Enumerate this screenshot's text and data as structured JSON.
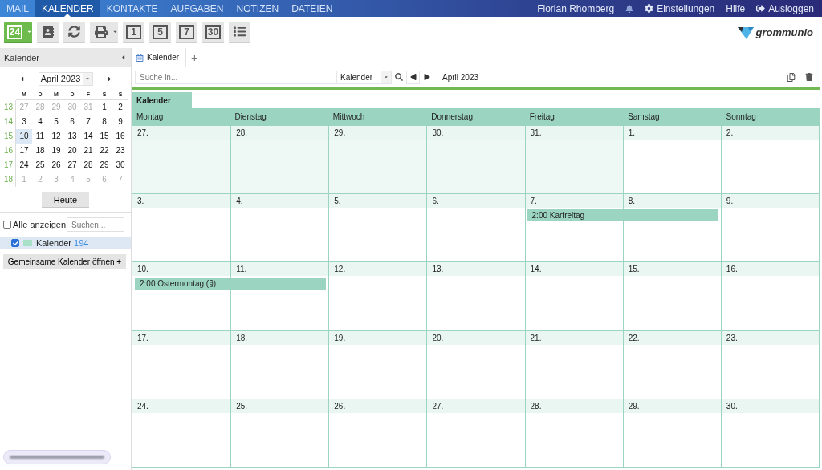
{
  "nav": {
    "tabs": [
      {
        "label": "MAIL",
        "selected": false
      },
      {
        "label": "KALENDER",
        "selected": true
      },
      {
        "label": "KONTAKTE",
        "selected": false
      },
      {
        "label": "AUFGABEN",
        "selected": false
      },
      {
        "label": "NOTIZEN",
        "selected": false
      },
      {
        "label": "DATEIEN",
        "selected": false
      }
    ],
    "user": "Florian Rhomberg",
    "settings": "Einstellungen",
    "help": "Hilfe",
    "logout": "Ausloggen"
  },
  "toolbar": {
    "buttons": [
      {
        "kind": "date",
        "label": "24",
        "dropdown": true,
        "highlighted": true
      },
      {
        "kind": "contacts",
        "dropdown": false,
        "highlighted": false
      },
      {
        "kind": "refresh",
        "dropdown": false,
        "highlighted": false
      },
      {
        "kind": "print",
        "dropdown": true,
        "highlighted": false
      },
      {
        "kind": "view",
        "label": "1",
        "dropdown": false,
        "highlighted": false
      },
      {
        "kind": "view",
        "label": "5",
        "dropdown": false,
        "highlighted": false
      },
      {
        "kind": "view",
        "label": "7",
        "dropdown": false,
        "highlighted": false
      },
      {
        "kind": "view",
        "label": "30",
        "dropdown": false,
        "highlighted": false
      },
      {
        "kind": "list",
        "dropdown": false,
        "highlighted": false
      }
    ],
    "logo": "grommunio"
  },
  "sidebar": {
    "title": "Kalender",
    "month": "April 2023",
    "weekdays": [
      "M",
      "D",
      "M",
      "D",
      "F",
      "S",
      "S"
    ],
    "weeks": [
      {
        "week": "13",
        "days": [
          {
            "label": "27",
            "outside": true,
            "selected": false
          },
          {
            "label": "28",
            "outside": true,
            "selected": false
          },
          {
            "label": "29",
            "outside": true,
            "selected": false
          },
          {
            "label": "30",
            "outside": true,
            "selected": false
          },
          {
            "label": "31",
            "outside": true,
            "selected": false
          },
          {
            "label": "1",
            "outside": false,
            "selected": false
          },
          {
            "label": "2",
            "outside": false,
            "selected": false
          }
        ]
      },
      {
        "week": "14",
        "days": [
          {
            "label": "3",
            "outside": false,
            "selected": false
          },
          {
            "label": "4",
            "outside": false,
            "selected": false
          },
          {
            "label": "5",
            "outside": false,
            "selected": false
          },
          {
            "label": "6",
            "outside": false,
            "selected": false
          },
          {
            "label": "7",
            "outside": false,
            "selected": false
          },
          {
            "label": "8",
            "outside": false,
            "selected": false
          },
          {
            "label": "9",
            "outside": false,
            "selected": false
          }
        ]
      },
      {
        "week": "15",
        "days": [
          {
            "label": "10",
            "outside": false,
            "selected": true
          },
          {
            "label": "11",
            "outside": false,
            "selected": false
          },
          {
            "label": "12",
            "outside": false,
            "selected": false
          },
          {
            "label": "13",
            "outside": false,
            "selected": false
          },
          {
            "label": "14",
            "outside": false,
            "selected": false
          },
          {
            "label": "15",
            "outside": false,
            "selected": false
          },
          {
            "label": "16",
            "outside": false,
            "selected": false
          }
        ]
      },
      {
        "week": "16",
        "days": [
          {
            "label": "17",
            "outside": false,
            "selected": false
          },
          {
            "label": "18",
            "outside": false,
            "selected": false
          },
          {
            "label": "19",
            "outside": false,
            "selected": false
          },
          {
            "label": "20",
            "outside": false,
            "selected": false
          },
          {
            "label": "21",
            "outside": false,
            "selected": false
          },
          {
            "label": "22",
            "outside": false,
            "selected": false
          },
          {
            "label": "23",
            "outside": false,
            "selected": false
          }
        ]
      },
      {
        "week": "17",
        "days": [
          {
            "label": "24",
            "outside": false,
            "selected": false
          },
          {
            "label": "25",
            "outside": false,
            "selected": false
          },
          {
            "label": "26",
            "outside": false,
            "selected": false
          },
          {
            "label": "27",
            "outside": false,
            "selected": false
          },
          {
            "label": "28",
            "outside": false,
            "selected": false
          },
          {
            "label": "29",
            "outside": false,
            "selected": false
          },
          {
            "label": "30",
            "outside": false,
            "selected": false
          }
        ]
      },
      {
        "week": "18",
        "days": [
          {
            "label": "1",
            "outside": true,
            "selected": false
          },
          {
            "label": "2",
            "outside": true,
            "selected": false
          },
          {
            "label": "3",
            "outside": true,
            "selected": false
          },
          {
            "label": "4",
            "outside": true,
            "selected": false
          },
          {
            "label": "5",
            "outside": true,
            "selected": false
          },
          {
            "label": "6",
            "outside": true,
            "selected": false
          },
          {
            "label": "7",
            "outside": true,
            "selected": false
          }
        ]
      }
    ],
    "today": "Heute",
    "show_all": {
      "label": "Alle anzeigen",
      "checked": false
    },
    "search": {
      "placeholder": "Suchen..."
    },
    "calendars": [
      {
        "name": "Kalender",
        "count": "194",
        "checked": true,
        "selected": true,
        "color": "#a8e0c8"
      }
    ],
    "open_shared": "Gemeinsame Kalender öffnen +"
  },
  "main": {
    "tabs": [
      {
        "label": "Kalender",
        "selected": true
      }
    ],
    "add_tab": "+",
    "search": {
      "placeholder": "Suche in..."
    },
    "scope": "Kalender",
    "period": "April 2023",
    "group_tab": "Kalender",
    "columns": [
      "Montag",
      "Dienstag",
      "Mittwoch",
      "Donnerstag",
      "Freitag",
      "Samstag",
      "Sonntag"
    ],
    "weeks": [
      {
        "days": [
          {
            "label": "27.",
            "outside": true
          },
          {
            "label": "28.",
            "outside": true
          },
          {
            "label": "29.",
            "outside": true
          },
          {
            "label": "30.",
            "outside": true
          },
          {
            "label": "31.",
            "outside": true
          },
          {
            "label": "1.",
            "outside": false
          },
          {
            "label": "2.",
            "outside": false
          }
        ]
      },
      {
        "days": [
          {
            "label": "3.",
            "outside": false
          },
          {
            "label": "4.",
            "outside": false
          },
          {
            "label": "5.",
            "outside": false
          },
          {
            "label": "6.",
            "outside": false
          },
          {
            "label": "7.",
            "outside": false,
            "events": [
              {
                "text": "2:00 Karfreitag",
                "kind": "two-day"
              }
            ]
          },
          {
            "label": "8.",
            "outside": false
          },
          {
            "label": "9.",
            "outside": false
          }
        ]
      },
      {
        "days": [
          {
            "label": "10.",
            "outside": false,
            "events": [
              {
                "text": "2:00 Ostermontag (§)",
                "kind": "two-day"
              }
            ]
          },
          {
            "label": "11.",
            "outside": false
          },
          {
            "label": "12.",
            "outside": false
          },
          {
            "label": "13.",
            "outside": false
          },
          {
            "label": "14.",
            "outside": false
          },
          {
            "label": "15.",
            "outside": false
          },
          {
            "label": "16.",
            "outside": false
          }
        ]
      },
      {
        "days": [
          {
            "label": "17.",
            "outside": false
          },
          {
            "label": "18.",
            "outside": false
          },
          {
            "label": "19.",
            "outside": false
          },
          {
            "label": "20.",
            "outside": false
          },
          {
            "label": "21.",
            "outside": false
          },
          {
            "label": "22.",
            "outside": false
          },
          {
            "label": "23.",
            "outside": false
          }
        ]
      },
      {
        "days": [
          {
            "label": "24.",
            "outside": false
          },
          {
            "label": "25.",
            "outside": false
          },
          {
            "label": "26.",
            "outside": false
          },
          {
            "label": "27.",
            "outside": false
          },
          {
            "label": "28.",
            "outside": false
          },
          {
            "label": "29.",
            "outside": false
          },
          {
            "label": "30.",
            "outside": false
          }
        ]
      }
    ]
  }
}
